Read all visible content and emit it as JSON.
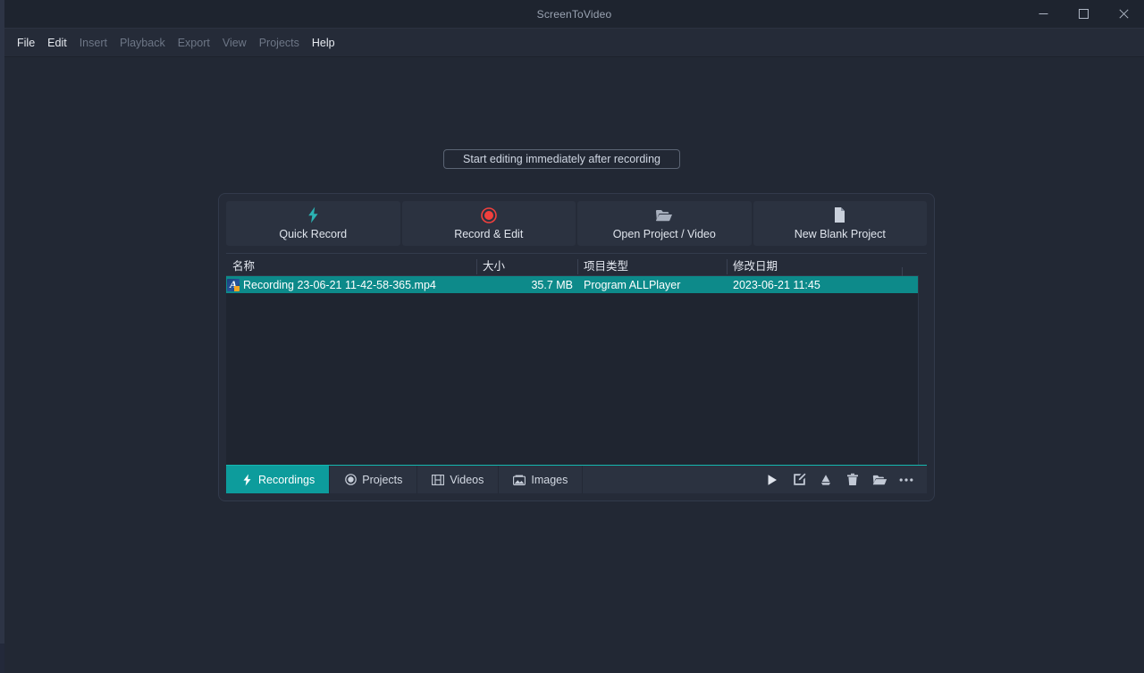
{
  "window": {
    "title": "ScreenToVideo",
    "controls": [
      {
        "name": "minimize",
        "label": "—"
      },
      {
        "name": "maximize",
        "label": "□"
      },
      {
        "name": "close",
        "label": "✕"
      }
    ]
  },
  "menubar": {
    "items": [
      {
        "label": "File",
        "enabled": true
      },
      {
        "label": "Edit",
        "enabled": true
      },
      {
        "label": "Insert",
        "enabled": false
      },
      {
        "label": "Playback",
        "enabled": false
      },
      {
        "label": "Export",
        "enabled": false
      },
      {
        "label": "View",
        "enabled": false
      },
      {
        "label": "Projects",
        "enabled": false
      },
      {
        "label": "Help",
        "enabled": true
      }
    ]
  },
  "hint": {
    "label": "Start editing immediately after recording"
  },
  "launcher": {
    "actions": [
      {
        "icon": "lightning-bolt-icon",
        "label": "Quick Record",
        "color": "#2bb3b3"
      },
      {
        "icon": "record-circle-icon",
        "label": "Record & Edit",
        "color": "#f2403d"
      },
      {
        "icon": "open-folder-icon",
        "label": "Open Project / Video",
        "color": "#a8b0be"
      },
      {
        "icon": "blank-document-icon",
        "label": "New Blank Project",
        "color": "#c9d0db"
      }
    ],
    "list": {
      "columns": [
        {
          "key": "name",
          "label": "名称"
        },
        {
          "key": "size",
          "label": "大小"
        },
        {
          "key": "type",
          "label": "项目类型"
        },
        {
          "key": "date",
          "label": "修改日期"
        }
      ],
      "rows": [
        {
          "icon": "allplayer-file-icon",
          "glyph": "A",
          "name": "Recording 23-06-21 11-42-58-365.mp4",
          "size": "35.7 MB",
          "type": "Program ALLPlayer",
          "date": "2023-06-21 11:45",
          "selected": true
        }
      ]
    },
    "tabs": [
      {
        "icon": "lightning-bolt-icon",
        "label": "Recordings",
        "active": true
      },
      {
        "icon": "record-circle-icon",
        "label": "Projects",
        "active": false
      },
      {
        "icon": "film-strip-icon",
        "label": "Videos",
        "active": false
      },
      {
        "icon": "image-icon",
        "label": "Images",
        "active": false
      }
    ],
    "tools": [
      {
        "icon": "play-icon",
        "title": "Play"
      },
      {
        "icon": "edit-square-icon",
        "title": "Edit"
      },
      {
        "icon": "cloud-upload-icon",
        "title": "Upload"
      },
      {
        "icon": "trash-icon",
        "title": "Delete"
      },
      {
        "icon": "open-folder-icon",
        "title": "Open folder"
      },
      {
        "icon": "more-options-icon",
        "title": "More"
      }
    ]
  },
  "colors": {
    "accent_teal": "#0d9c9c",
    "accent_teal_line": "#14b8b0",
    "record_red": "#f2403d",
    "bolt_teal": "#2bb3b3",
    "panel_bg": "#252b38",
    "window_bg": "#222834",
    "list_bg": "#1f2530",
    "titlebar_bg": "#1e242f"
  }
}
